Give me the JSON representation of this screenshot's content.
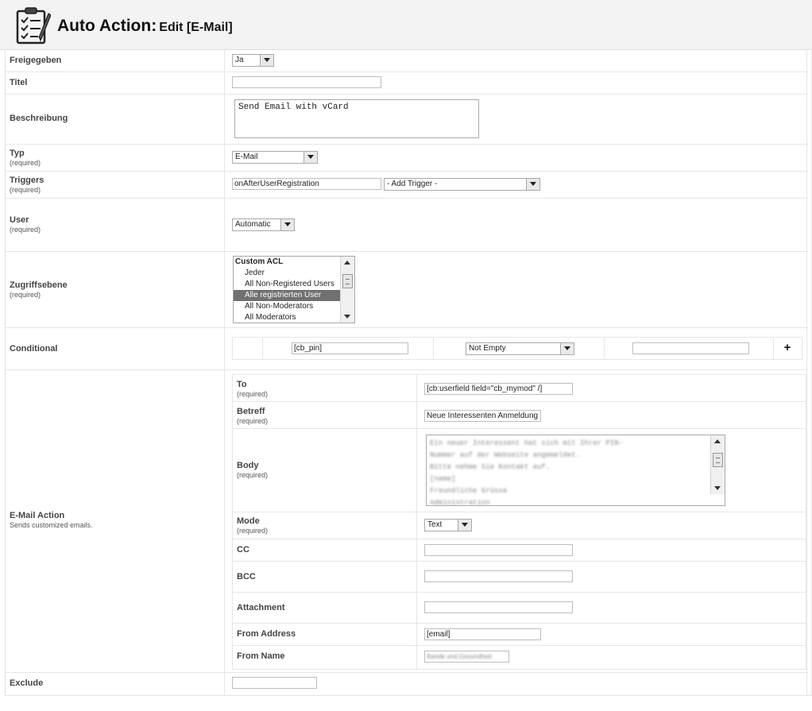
{
  "header": {
    "title_main": "Auto Action:",
    "title_sub": "Edit [E-Mail]",
    "logo_icon": "checklist-icon"
  },
  "fields": {
    "freigegeben": {
      "label": "Freigegeben",
      "value": "Ja"
    },
    "titel": {
      "label": "Titel",
      "value": ""
    },
    "beschreibung": {
      "label": "Beschreibung",
      "value": "Send Email with vCard"
    },
    "typ": {
      "label": "Typ",
      "required": "(required)",
      "value": "E-Mail"
    },
    "triggers": {
      "label": "Triggers",
      "required": "(required)",
      "value": "onAfterUserRegistration",
      "add_trigger": "- Add Trigger -"
    },
    "user": {
      "label": "User",
      "required": "(required)",
      "value": "Automatic"
    },
    "zugriffsebene": {
      "label": "Zugriffsebene",
      "required": "(required)",
      "group": "Custom ACL",
      "options": [
        "Jeder",
        "All Non-Registered Users",
        "Alle registrierten User",
        "All Non-Moderators",
        "All Moderators"
      ],
      "selected": "Alle registrierten User"
    },
    "conditional": {
      "label": "Conditional",
      "field": "[cb_pin]",
      "operator": "Not Empty",
      "value": "",
      "add": "+"
    },
    "email_action": {
      "label": "E-Mail Action",
      "description": "Sends customized emails.",
      "to": {
        "label": "To",
        "required": "(required)",
        "value": "[cb:userfield field=\"cb_mymod\" /]"
      },
      "betreff": {
        "label": "Betreff",
        "required": "(required)",
        "value": "Neue Interessenten Anmeldung"
      },
      "body": {
        "label": "Body",
        "required": "(required)",
        "lines": [
          "Ein neuer Interessent hat sich mit Ihrer PIN-",
          "Nummer auf der Webseite angemeldet.",
          "Bitte nehme Sie Kontakt auf.",
          "[name]",
          "Freundliche Grüsse",
          "Administration"
        ]
      },
      "mode": {
        "label": "Mode",
        "required": "(required)",
        "value": "Text"
      },
      "cc": {
        "label": "CC",
        "value": ""
      },
      "bcc": {
        "label": "BCC",
        "value": ""
      },
      "attachment": {
        "label": "Attachment",
        "value": ""
      },
      "from_address": {
        "label": "From Address",
        "value": "[email]"
      },
      "from_name": {
        "label": "From Name",
        "value": "Bande und Gesundheit"
      }
    },
    "exclude": {
      "label": "Exclude",
      "value": ""
    }
  }
}
